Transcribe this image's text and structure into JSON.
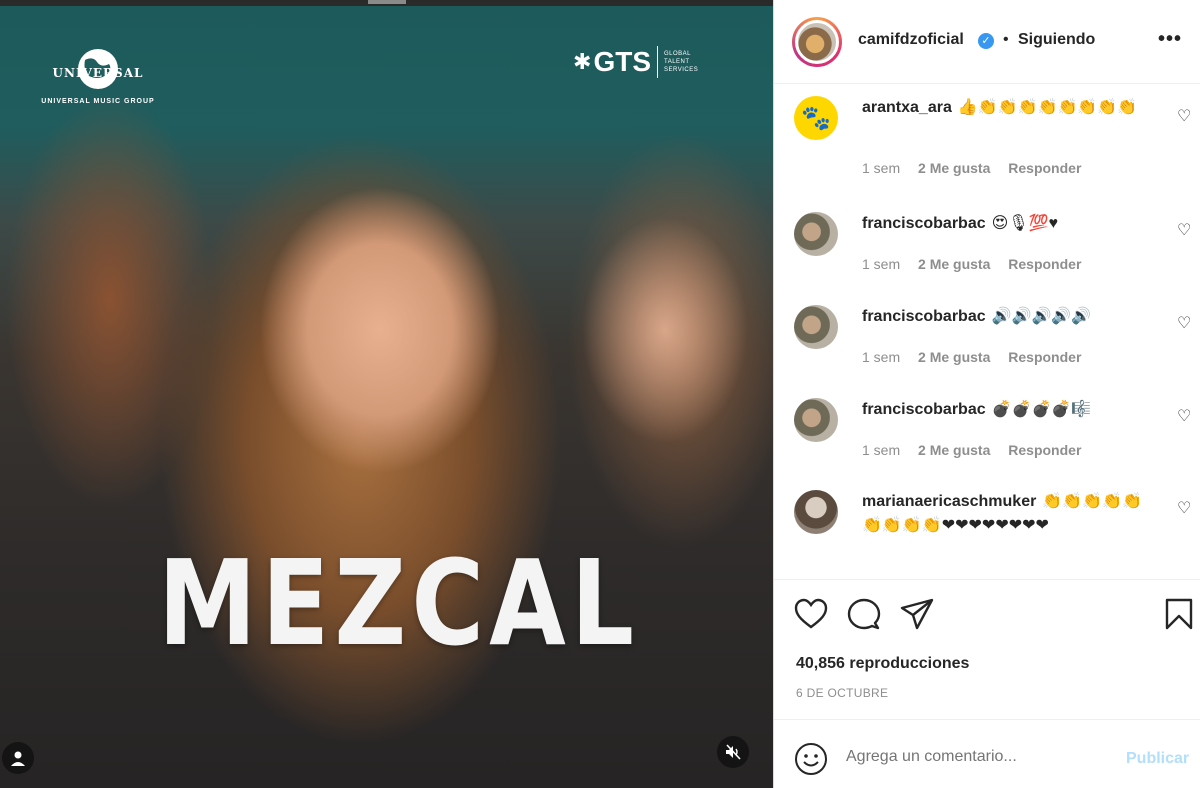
{
  "media": {
    "universal_logo_word": "UNIVERSAL",
    "universal_logo_sub": "UNIVERSAL MUSIC GROUP",
    "gts_logo_word": "GTS",
    "gts_logo_sub": [
      "GLOBAL",
      "TALENT",
      "SERVICES"
    ],
    "overlay_title": "MEZCAL",
    "icons": [
      "user-tag-icon",
      "muted-speaker-icon"
    ]
  },
  "post": {
    "username": "camifdzoficial",
    "verified": true,
    "separator": "•",
    "follow_status": "Siguiendo",
    "more_label": "•••"
  },
  "comments": [
    {
      "username": "arantxa_ara",
      "text": "👍👏👏👏👏👏👏👏👏",
      "time": "1 sem",
      "likes": "2 Me gusta",
      "reply": "Responder",
      "avatar": "paw-icon"
    },
    {
      "username": "franciscobarbac",
      "text": "😍🎙💯♥",
      "time": "1 sem",
      "likes": "2 Me gusta",
      "reply": "Responder",
      "avatar": "photo"
    },
    {
      "username": "franciscobarbac",
      "text": "🔊🔊🔊🔊🔊",
      "time": "1 sem",
      "likes": "2 Me gusta",
      "reply": "Responder",
      "avatar": "photo"
    },
    {
      "username": "franciscobarbac",
      "text": "💣💣💣💣🎼",
      "time": "1 sem",
      "likes": "2 Me gusta",
      "reply": "Responder",
      "avatar": "photo"
    },
    {
      "username": "marianaericaschmuker",
      "text": "👏👏👏👏👏👏👏👏👏❤❤❤❤❤❤❤❤",
      "time": "",
      "likes": "",
      "reply": "",
      "avatar": "photo"
    }
  ],
  "actions": {
    "icons": [
      "heart-icon",
      "comment-icon",
      "share-icon",
      "bookmark-icon"
    ],
    "views": "40,856 reproducciones",
    "date": "6 DE OCTUBRE"
  },
  "add_comment": {
    "placeholder": "Agrega un comentario...",
    "publish_label": "Publicar"
  },
  "colors": {
    "verified": "#3897f0",
    "publish_disabled": "#b2dffc",
    "meta_text": "#8e8e8e",
    "heart_red": "#e0245e"
  }
}
